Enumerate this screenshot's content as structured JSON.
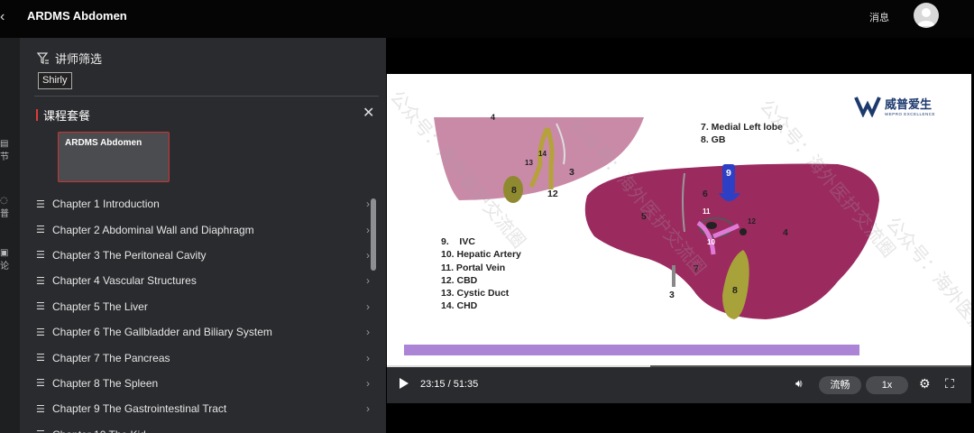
{
  "header": {
    "back_icon": "back-icon",
    "title": "ARDMS Abdomen",
    "messages_label": "消息"
  },
  "rail": {
    "items": [
      {
        "icon": "chapter-icon",
        "label": "节"
      },
      {
        "icon": "note-icon",
        "label": "普"
      },
      {
        "icon": "discuss-icon",
        "label": "论"
      }
    ]
  },
  "panel": {
    "filter_label": "讲师筛选",
    "filter_chip": "Shirly",
    "package_title": "课程套餐",
    "course_card": "ARDMS Abdomen",
    "chapters": [
      "Chapter 1 Introduction",
      "Chapter 2 Abdominal Wall and Diaphragm",
      "Chapter 3 The Peritoneal Cavity",
      "Chapter 4 Vascular Structures",
      "Chapter 5 The Liver",
      "Chapter 6 The Gallbladder and Biliary System",
      "Chapter 7 The Pancreas",
      "Chapter 8 The Spleen",
      "Chapter 9 The Gastrointestinal Tract",
      "Chapter 10 The Kid"
    ]
  },
  "slide": {
    "legend_top": [
      "7. Medial Left lobe",
      "8. GB"
    ],
    "legend_left": [
      "9.    IVC",
      "10. Hepatic Artery",
      "11. Portal Vein",
      "12. CBD",
      "13. Cystic Duct",
      "14. CHD"
    ],
    "logo_text": "威普爱生",
    "logo_sub": "WEPRO EXCELLENCE",
    "watermark": "公众号：海外医护交流圈",
    "labels": {
      "n3a": "3",
      "n4a": "4",
      "n5": "5",
      "n6": "6",
      "n7": "7",
      "n8a": "8",
      "n8b": "8",
      "n9": "9",
      "n10": "10",
      "n11": "11",
      "n12a": "12",
      "n12b": "12",
      "n13": "13",
      "n14": "14",
      "n3b": "3"
    }
  },
  "player": {
    "time": "23:15 / 51:35",
    "progress": 0.45,
    "quality": "流畅",
    "speed": "1x"
  },
  "colors": {
    "liver": "#9b2a5f",
    "liver_light": "#c98aa8",
    "gallbladder": "#a8a23a",
    "ivc": "#2d3fc4",
    "artery": "#e07ad8",
    "accent_red": "#e03a3a"
  }
}
